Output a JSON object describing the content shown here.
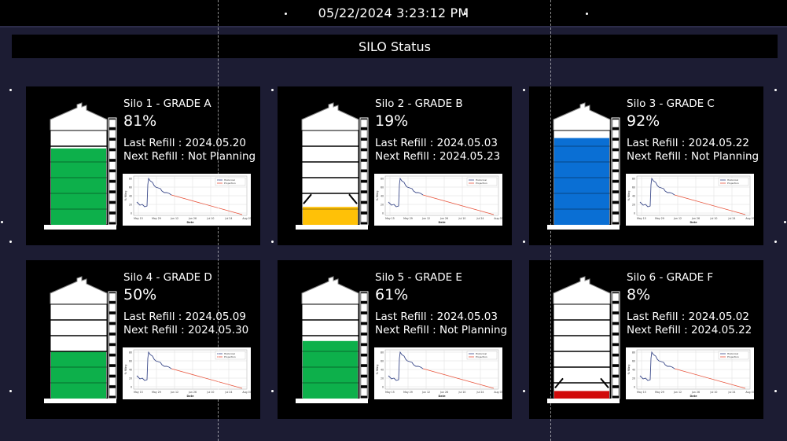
{
  "header": {
    "datetime": "05/22/2024 3:23:12 PM"
  },
  "panel": {
    "title": "SILO Status"
  },
  "labels": {
    "last_refill": "Last Refill : ",
    "next_refill": "Next Refill : "
  },
  "colors": {
    "green": "#0db04b",
    "yellow": "#ffc107",
    "blue": "#0a6fd4",
    "red": "#d10a0a",
    "background": "#1c1c33"
  },
  "silos": [
    {
      "name": "Silo 1 - GRADE A",
      "percent_label": "81%",
      "level": 0.81,
      "color": "green",
      "last_refill": "2024.05.20",
      "next_refill": "Not Planning"
    },
    {
      "name": "Silo 2 - GRADE B",
      "percent_label": "19%",
      "level": 0.19,
      "color": "yellow",
      "last_refill": "2024.05.03",
      "next_refill": "2024.05.23"
    },
    {
      "name": "Silo 3 - GRADE C",
      "percent_label": "92%",
      "level": 0.92,
      "color": "blue",
      "last_refill": "2024.05.22",
      "next_refill": "Not Planning"
    },
    {
      "name": "Silo 4 - GRADE D",
      "percent_label": "50%",
      "level": 0.5,
      "color": "green",
      "last_refill": "2024.05.09",
      "next_refill": "2024.05.30"
    },
    {
      "name": "Silo 5 - GRADE E",
      "percent_label": "61%",
      "level": 0.61,
      "color": "green",
      "last_refill": "2024.05.03",
      "next_refill": "Not Planning"
    },
    {
      "name": "Silo 6 - GRADE F",
      "percent_label": "8%",
      "level": 0.08,
      "color": "red",
      "last_refill": "2024.05.02",
      "next_refill": "2024.05.22"
    }
  ],
  "mini_chart": {
    "x_ticks": [
      "May 15",
      "May 29",
      "Jun 12",
      "Jun 26",
      "Jul 10",
      "Jul 24",
      "Aug 07"
    ],
    "y_ticks": [
      "80",
      "60",
      "40",
      "20",
      "0"
    ],
    "y_label": "% filling",
    "x_label": "Date",
    "legend": [
      "Historical",
      "Projection"
    ],
    "series_colors": {
      "historical": "#3b4a8a",
      "projection": "#e8543c"
    }
  }
}
